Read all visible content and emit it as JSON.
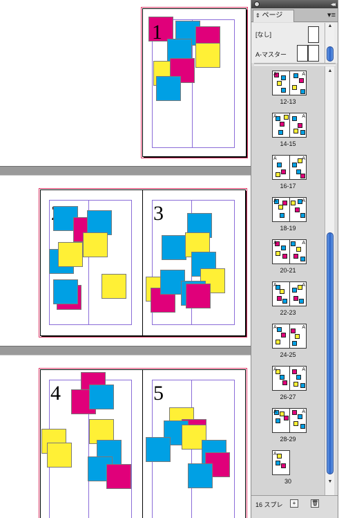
{
  "document": {
    "pages": [
      "1",
      "2",
      "3",
      "4",
      "5"
    ]
  },
  "panel": {
    "tab_label": "ページ",
    "tab_sort_icon": "updown-arrows-icon",
    "menu_icon": "panel-menu-icon",
    "collapse_icon": "double-arrow-icon",
    "masters": [
      {
        "label": "[なし]"
      },
      {
        "label": "A-マスター"
      }
    ],
    "spreads": [
      {
        "label": "12-13",
        "left": "12",
        "right": "13",
        "single": false
      },
      {
        "label": "14-15",
        "left": "14",
        "right": "15",
        "single": false
      },
      {
        "label": "16-17",
        "left": "16",
        "right": "17",
        "single": false
      },
      {
        "label": "18-19",
        "left": "18",
        "right": "19",
        "single": false
      },
      {
        "label": "20-21",
        "left": "20",
        "right": "21",
        "single": false
      },
      {
        "label": "22-23",
        "left": "22",
        "right": "23",
        "single": false
      },
      {
        "label": "24-25",
        "left": "24",
        "right": "25",
        "single": false
      },
      {
        "label": "26-27",
        "left": "26",
        "right": "27",
        "single": false
      },
      {
        "label": "28-29",
        "left": "28",
        "right": "29",
        "single": false
      },
      {
        "label": "30",
        "left": "30",
        "right": "",
        "single": true
      }
    ],
    "footer_text": "16 スプレ",
    "thumb_master_prefix": "A"
  },
  "colors": {
    "magenta": "#e0007a",
    "cyan": "#00a0e4",
    "yellow": "#fff036",
    "bleed": "#e03a6a",
    "margin_guide": "#8a6cd8",
    "scroll_thumb": "#2c64c8"
  }
}
